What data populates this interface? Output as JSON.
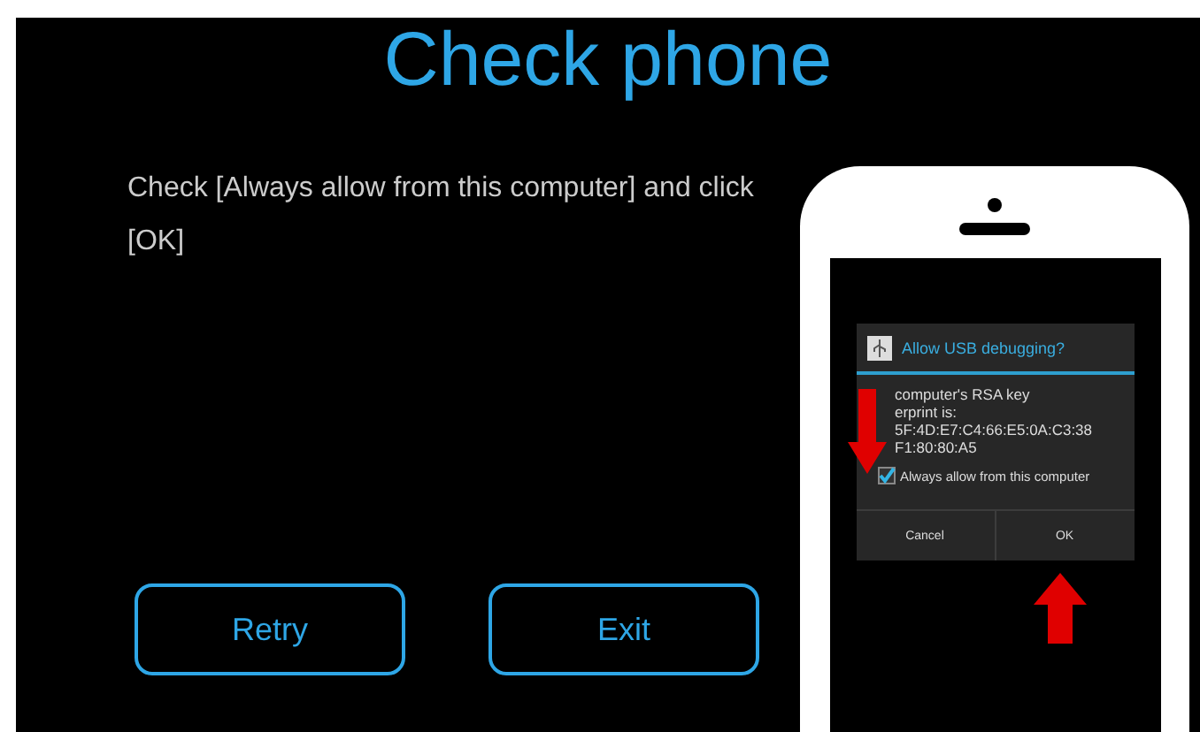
{
  "title": "Check phone",
  "instruction": "Check [Always allow from this computer] and click [OK]",
  "buttons": [
    {
      "label": "Retry"
    },
    {
      "label": "Exit"
    }
  ],
  "phone_dialog": {
    "title": "Allow USB debugging?",
    "message_lines": [
      "computer's RSA key",
      "erprint is:",
      "5F:4D:E7:C4:66:E5:0A:C3:38",
      "F1:80:80:A5"
    ],
    "checkbox": {
      "label": "Always allow from this computer",
      "checked": true
    },
    "buttons": [
      {
        "label": "Cancel"
      },
      {
        "label": "OK"
      }
    ]
  }
}
